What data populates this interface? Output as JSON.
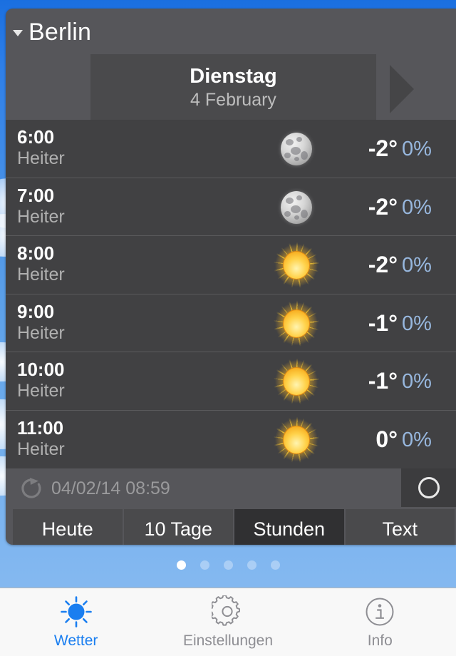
{
  "app": {
    "background_top_color": "#1a6fe0",
    "background_bottom_color": "#8dbdf2"
  },
  "header": {
    "city": "Berlin",
    "city_expand_icon": "triangle-down-icon",
    "date_day": "Dienstag",
    "date_sub": "4 February",
    "next_day_icon": "triangle-right-icon"
  },
  "hourly": {
    "rows": [
      {
        "time": "6:00",
        "condition": "Heiter",
        "icon": "moon-icon",
        "temperature": "-2°",
        "precipitation": "0%"
      },
      {
        "time": "7:00",
        "condition": "Heiter",
        "icon": "moon-icon",
        "temperature": "-2°",
        "precipitation": "0%"
      },
      {
        "time": "8:00",
        "condition": "Heiter",
        "icon": "sun-icon",
        "temperature": "-2°",
        "precipitation": "0%"
      },
      {
        "time": "9:00",
        "condition": "Heiter",
        "icon": "sun-icon",
        "temperature": "-1°",
        "precipitation": "0%"
      },
      {
        "time": "10:00",
        "condition": "Heiter",
        "icon": "sun-icon",
        "temperature": "-1°",
        "precipitation": "0%"
      },
      {
        "time": "11:00",
        "condition": "Heiter",
        "icon": "sun-icon",
        "temperature": "0°",
        "precipitation": "0%"
      }
    ],
    "precipitation_color": "#97b7de"
  },
  "refresh": {
    "icon": "refresh-icon",
    "last_updated": "04/02/14 08:59",
    "circle_button_icon": "circle-icon"
  },
  "segments": {
    "items": [
      {
        "label": "Heute",
        "active": false
      },
      {
        "label": "10 Tage",
        "active": false
      },
      {
        "label": "Stunden",
        "active": true
      },
      {
        "label": "Text",
        "active": false
      }
    ]
  },
  "page_dots": {
    "count": 5,
    "active_index": 0
  },
  "tabbar": {
    "accent_color": "#1a7ef0",
    "inactive_color": "#8e8e93",
    "items": [
      {
        "label": "Wetter",
        "icon": "sun-icon",
        "active": true
      },
      {
        "label": "Einstellungen",
        "icon": "gear-icon",
        "active": false
      },
      {
        "label": "Info",
        "icon": "info-icon",
        "active": false
      }
    ]
  }
}
